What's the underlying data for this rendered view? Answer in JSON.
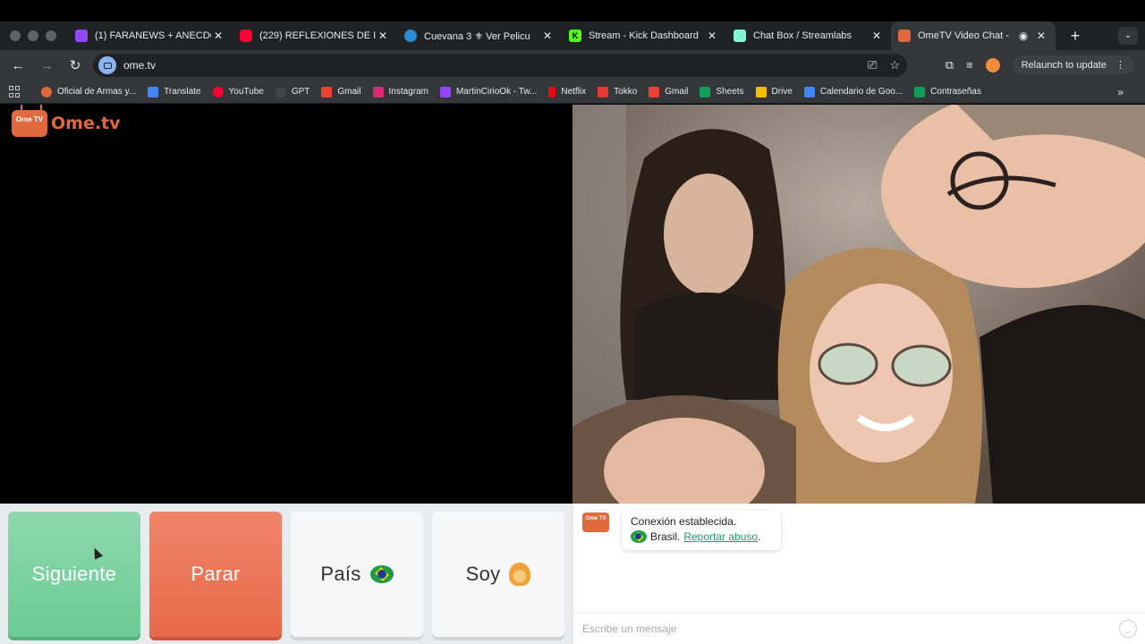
{
  "browser": {
    "tabs": [
      {
        "title": "(1) FARANEWS + ANECDO",
        "favicon": "twitch-icon",
        "color": "#9146ff"
      },
      {
        "title": "(229) REFLEXIONES DE I",
        "favicon": "youtube-icon",
        "color": "#ff0033"
      },
      {
        "title": "Cuevana 3 ⚜ Ver Pelicu",
        "favicon": "cuevana-icon",
        "color": "#2a8ad4"
      },
      {
        "title": "Stream - Kick Dashboard",
        "favicon": "kick-icon",
        "color": "#53fc18"
      },
      {
        "title": "Chat Box / Streamlabs",
        "favicon": "streamlabs-icon",
        "color": "#80f5d2"
      },
      {
        "title": "OmeTV Video Chat -",
        "favicon": "ometv-icon",
        "color": "#e2693e",
        "active": true
      }
    ],
    "url": "ome.tv",
    "relaunch_label": "Relaunch to update",
    "bookmarks": [
      {
        "label": "Oficial de Armas y...",
        "color": "#e2693e"
      },
      {
        "label": "Translate",
        "color": "#4285f4"
      },
      {
        "label": "YouTube",
        "color": "#ff0033"
      },
      {
        "label": "GPT",
        "color": "#444444"
      },
      {
        "label": "Gmail",
        "color": "#ea4335"
      },
      {
        "label": "Instagram",
        "color": "#d62976"
      },
      {
        "label": "MartinCirioOk - Tw...",
        "color": "#9146ff"
      },
      {
        "label": "Netflix",
        "color": "#e50914"
      },
      {
        "label": "Tokko",
        "color": "#e53935"
      },
      {
        "label": "Gmail",
        "color": "#ea4335"
      },
      {
        "label": "Sheets",
        "color": "#0f9d58"
      },
      {
        "label": "Drive",
        "color": "#fbbc04"
      },
      {
        "label": "Calendario de Goo...",
        "color": "#4285f4"
      },
      {
        "label": "Contraseñas",
        "color": "#0f9d58"
      }
    ]
  },
  "page": {
    "logo_text": "Ome.tv",
    "logo_badge": "Ome TV",
    "buttons": {
      "next": "Siguiente",
      "stop": "Parar",
      "country": "País",
      "gender": "Soy"
    },
    "chat": {
      "status": "Conexión establecida.",
      "country": "Brasil.",
      "report_link": "Reportar abuso",
      "report_suffix": ".",
      "placeholder": "Escribe un mensaje"
    }
  }
}
